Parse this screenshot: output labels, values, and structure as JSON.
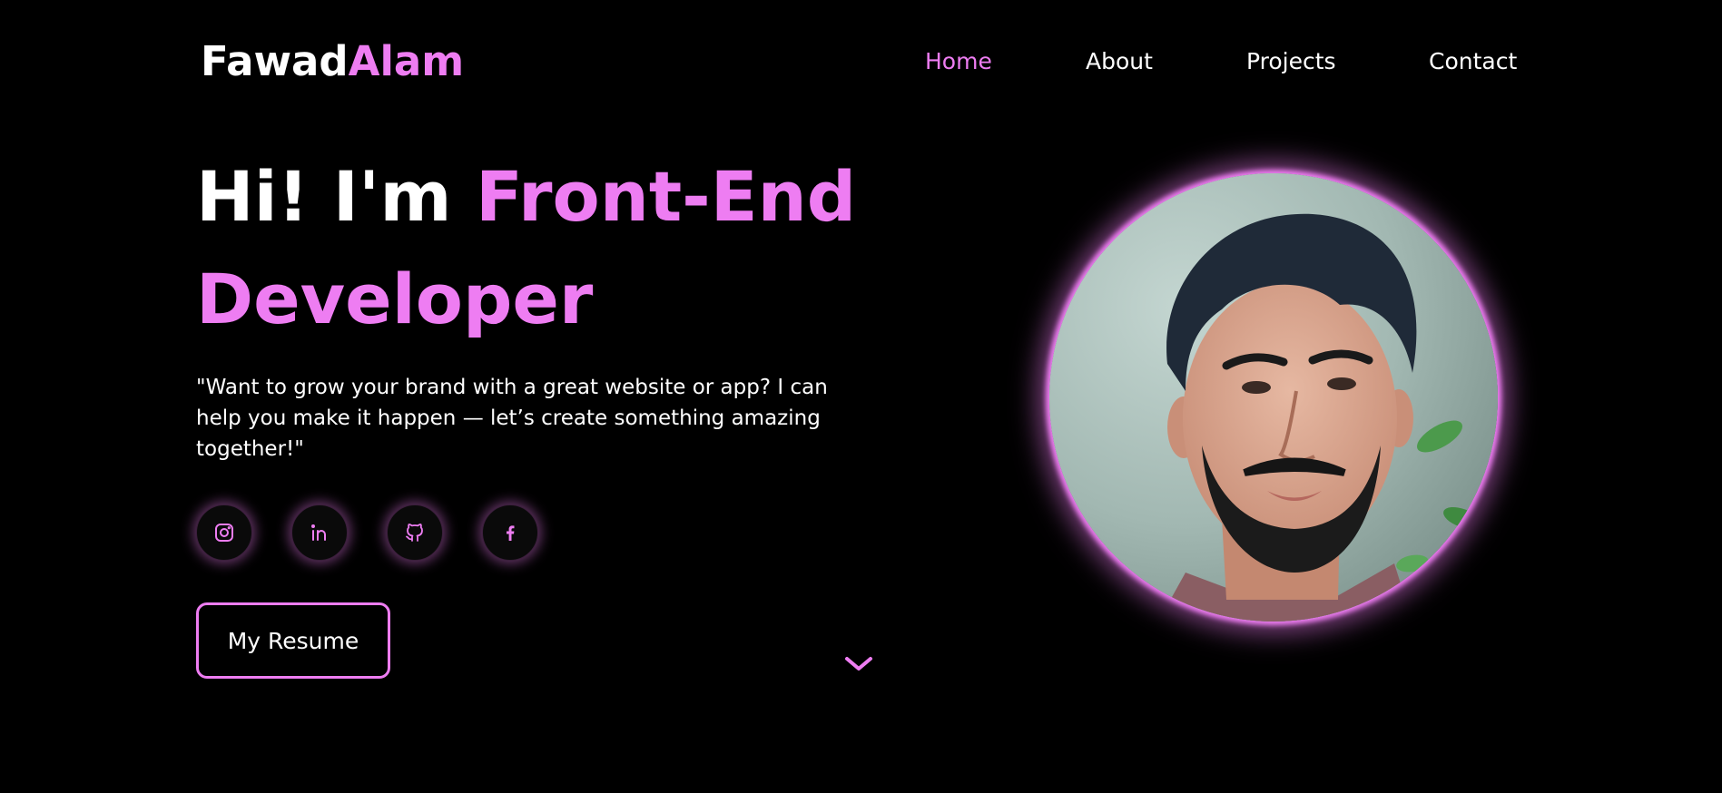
{
  "header": {
    "logo_first": "Fawad",
    "logo_last": "Alam",
    "nav": [
      {
        "label": "Home",
        "active": true
      },
      {
        "label": "About",
        "active": false
      },
      {
        "label": "Projects",
        "active": false
      },
      {
        "label": "Contact",
        "active": false
      }
    ]
  },
  "hero": {
    "title_white": "Hi! I'm ",
    "title_pink_1": "Front-End",
    "title_pink_2": "Developer",
    "tagline": "\"Want to grow your brand with a great website or app? I can help you make it happen — let’s create something amazing together!\"",
    "socials": [
      {
        "icon": "instagram-icon"
      },
      {
        "icon": "linkedin-icon"
      },
      {
        "icon": "github-icon"
      },
      {
        "icon": "facebook-icon"
      }
    ],
    "resume_label": "My Resume",
    "scroll_icon": "chevron-down-icon"
  },
  "portrait": {
    "icon": "profile-photo"
  },
  "colors": {
    "accent": "#ee7df2",
    "background": "#000000",
    "text": "#ffffff"
  }
}
